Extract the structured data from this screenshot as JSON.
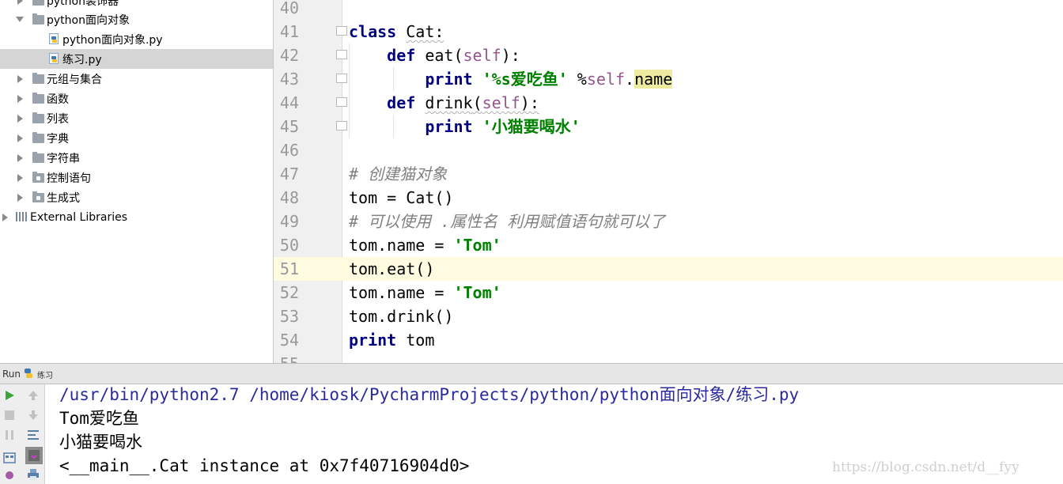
{
  "tree": {
    "items": [
      {
        "label": "python装饰器",
        "kind": "folder",
        "state": "collapsed"
      },
      {
        "label": "python面向对象",
        "kind": "folder",
        "state": "expanded"
      },
      {
        "label": "python面向对象.py",
        "kind": "pyfile"
      },
      {
        "label": "练习.py",
        "kind": "pyfile",
        "selected": true
      },
      {
        "label": "元组与集合",
        "kind": "folder",
        "state": "collapsed"
      },
      {
        "label": "函数",
        "kind": "folder",
        "state": "collapsed"
      },
      {
        "label": "列表",
        "kind": "folder",
        "state": "collapsed"
      },
      {
        "label": "字典",
        "kind": "folder",
        "state": "collapsed"
      },
      {
        "label": "字符串",
        "kind": "folder",
        "state": "collapsed"
      },
      {
        "label": "控制语句",
        "kind": "folder",
        "state": "collapsed"
      },
      {
        "label": "生成式",
        "kind": "folder",
        "state": "collapsed"
      },
      {
        "label": "External Libraries",
        "kind": "library",
        "state": "collapsed"
      }
    ]
  },
  "editor": {
    "current_line": "51",
    "lines": [
      {
        "n": "40",
        "code": ""
      },
      {
        "n": "41",
        "code": "class Cat:"
      },
      {
        "n": "42",
        "code": "    def eat(self):"
      },
      {
        "n": "43",
        "code": "        print '%s爱吃鱼' %self.name"
      },
      {
        "n": "44",
        "code": "    def drink(self):"
      },
      {
        "n": "45",
        "code": "        print '小猫要喝水'"
      },
      {
        "n": "46",
        "code": ""
      },
      {
        "n": "47",
        "code": "# 创建猫对象"
      },
      {
        "n": "48",
        "code": "tom = Cat()"
      },
      {
        "n": "49",
        "code": "# 可以使用 .属性名 利用赋值语句就可以了"
      },
      {
        "n": "50",
        "code": "tom.name = 'Tom'"
      },
      {
        "n": "51",
        "code": "tom.eat()"
      },
      {
        "n": "52",
        "code": "tom.name = 'Tom'"
      },
      {
        "n": "53",
        "code": "tom.drink()"
      },
      {
        "n": "54",
        "code": "print tom"
      },
      {
        "n": "55",
        "code": ""
      }
    ],
    "tokens": {
      "class_kw": "class",
      "class_name": "Cat",
      "colon": ":",
      "def_kw": "def",
      "eat": "eat",
      "drink": "drink",
      "lparen": "(",
      "rparen_colon": "):",
      "self": "self",
      "print_kw": "print",
      "str_eat": "'%s爱吃鱼'",
      "pct": " %",
      "dot": ".",
      "name": "name",
      "str_drink": "'小猫要喝水'",
      "comment1": "# 创建猫对象",
      "comment2": "# 可以使用 .属性名 利用赋值语句就可以了",
      "tom_cat": "tom = Cat()",
      "tom_name": "tom.name = ",
      "str_tom": "'Tom'",
      "tom_eat": "tom.eat()",
      "tom_drink": "tom.drink()",
      "tom": " tom"
    }
  },
  "run": {
    "tab_label": "Run",
    "config_name": "练习",
    "output": [
      "/usr/bin/python2.7 /home/kiosk/PycharmProjects/python/python面向对象/练习.py",
      "Tom爱吃鱼",
      "小猫要喝水",
      "<__main__.Cat instance at 0x7f40716904d0>"
    ]
  },
  "watermark": "https://blog.csdn.net/d__fyy",
  "colors": {
    "keyword": "#000080",
    "string": "#008000",
    "self": "#94558d",
    "comment": "#808080",
    "path": "#2a2a9c",
    "caret_row": "#fffbe0"
  }
}
